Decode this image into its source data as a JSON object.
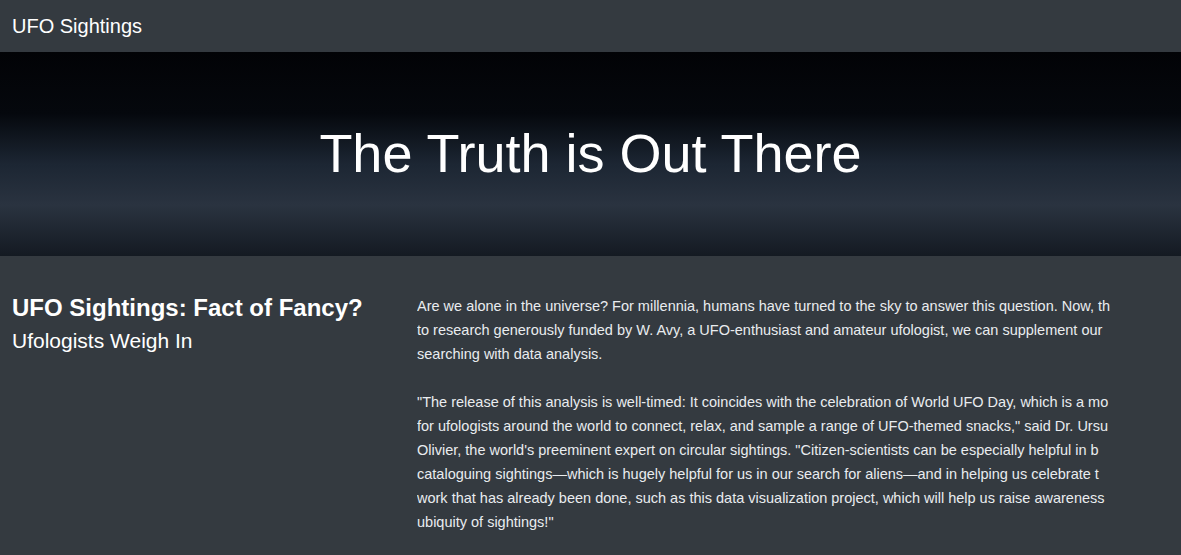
{
  "navbar": {
    "brand": "UFO Sightings"
  },
  "hero": {
    "title": "The Truth is Out There"
  },
  "article": {
    "title": "UFO Sightings: Fact of Fancy?",
    "subtitle": "Ufologists Weigh In",
    "paragraphs": [
      [
        "Are we alone in the universe? For millennia, humans have turned to the sky to answer this question. Now, th",
        "to research generously funded by W. Avy, a UFO-enthusiast and amateur ufologist, we can supplement our",
        "searching with data analysis."
      ],
      [
        "\"The release of this analysis is well-timed: It coincides with the celebration of World UFO Day, which is a mo",
        "for ufologists around the world to connect, relax, and sample a range of UFO-themed snacks,\" said Dr. Ursu",
        "Olivier, the world's preeminent expert on circular sightings. \"Citizen-scientists can be especially helpful in b",
        "cataloguing sightings—which is hugely helpful for us in our search for aliens—and in helping us celebrate t",
        "work that has already been done, such as this data visualization project, which will help us raise awareness",
        "ubiquity of sightings!\""
      ]
    ]
  }
}
